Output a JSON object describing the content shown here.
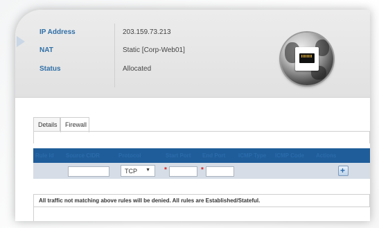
{
  "info": {
    "ip_label": "IP Address",
    "ip_value": "203.159.73.213",
    "nat_label": "NAT",
    "nat_value": "Static [Corp-Web01]",
    "status_label": "Status",
    "status_value": "Allocated"
  },
  "header_icon": "network-port-globe-icon",
  "tabs": [
    {
      "label": "Details",
      "active": false
    },
    {
      "label": "Firewall",
      "active": true
    }
  ],
  "firewall": {
    "columns": [
      "Rule Id",
      "Source CIDR",
      "Protocol",
      "Start Port",
      "End Port",
      "ICMP Type",
      "ICMP Code",
      "Actions"
    ],
    "protocol_selected": "TCP",
    "source_cidr_value": "",
    "start_port_value": "",
    "end_port_value": "",
    "required_marker": "*",
    "add_icon": "plus-icon",
    "add_symbol": "+",
    "notice": "All traffic not matching above rules will be denied. All rules are Established/Stateful."
  },
  "colors": {
    "grid_header_bg": "#1f5d9a",
    "label_blue": "#2e6ea6",
    "required_red": "#d81f1f"
  }
}
